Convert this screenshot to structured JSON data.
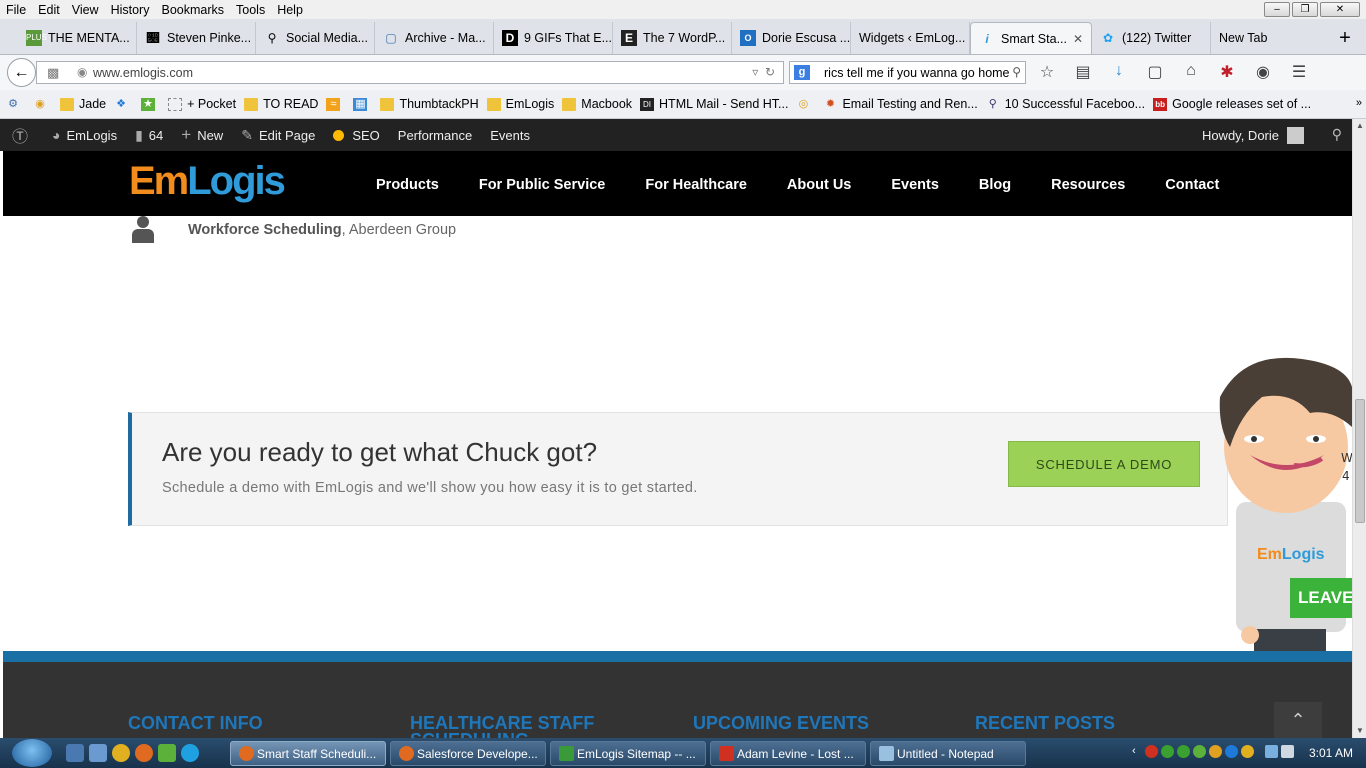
{
  "menubar": {
    "items": [
      "File",
      "Edit",
      "View",
      "History",
      "Bookmarks",
      "Tools",
      "Help"
    ]
  },
  "tabs": [
    {
      "label": "THE MENTA...",
      "icon": "plus-icon"
    },
    {
      "label": "Steven Pinke...",
      "icon": "nyt-icon"
    },
    {
      "label": "Social Media...",
      "icon": "search-icon"
    },
    {
      "label": "Archive - Ma...",
      "icon": "bookmark-icon"
    },
    {
      "label": "9 GIFs That E...",
      "icon": "d-icon"
    },
    {
      "label": "The 7 WordP...",
      "icon": "e-icon"
    },
    {
      "label": "Dorie Escusa ...",
      "icon": "outlook-icon"
    },
    {
      "label": "Widgets ‹ EmLog...",
      "icon": "none"
    },
    {
      "label": "Smart Sta...",
      "icon": "emlogis-icon",
      "active": true
    },
    {
      "label": "(122) Twitter",
      "icon": "twitter-icon"
    },
    {
      "label": "New Tab",
      "icon": "none"
    }
  ],
  "navbar": {
    "url": "www.emlogis.com",
    "search_value": "rics tell me if you wanna go home"
  },
  "bookmarks": [
    {
      "label": "",
      "icon": "gear-icon"
    },
    {
      "label": "",
      "icon": "chrome-icon"
    },
    {
      "label": "Jade",
      "icon": "folder-icon"
    },
    {
      "label": "",
      "icon": "dropbox-icon"
    },
    {
      "label": "",
      "icon": "evernote-icon"
    },
    {
      "label": "+ Pocket",
      "icon": "page-icon"
    },
    {
      "label": "TO READ",
      "icon": "folder-icon"
    },
    {
      "label": "",
      "icon": "rss-icon"
    },
    {
      "label": "",
      "icon": "grid-icon"
    },
    {
      "label": "ThumbtackPH",
      "icon": "folder-icon"
    },
    {
      "label": "EmLogis",
      "icon": "folder-icon"
    },
    {
      "label": "Macbook",
      "icon": "folder-icon"
    },
    {
      "label": "HTML Mail - Send HT...",
      "icon": "di-icon"
    },
    {
      "label": "",
      "icon": "circle-icon"
    },
    {
      "label": "Email Testing and Ren...",
      "icon": "litmus-icon"
    },
    {
      "label": "10 Successful Faceboo...",
      "icon": "search-icon"
    },
    {
      "label": "Google releases set of ...",
      "icon": "bb-icon"
    }
  ],
  "wpbar": {
    "site": "EmLogis",
    "comments": "64",
    "new": "New",
    "edit": "Edit Page",
    "seo": "SEO",
    "performance": "Performance",
    "events": "Events",
    "howdy": "Howdy, Dorie"
  },
  "site": {
    "logo_em": "Em",
    "logo_logis": "Logis",
    "nav": [
      "Products",
      "For Public Service",
      "For Healthcare",
      "About Us",
      "Events",
      "Blog",
      "Resources",
      "Contact"
    ]
  },
  "testimonial": {
    "source_bold": "Workforce Scheduling",
    "source_rest": ", Aberdeen Group"
  },
  "cta": {
    "heading": "Are you ready to get what Chuck got?",
    "sub": "Schedule a demo with EmLogis and we'll show you how easy it is to get started.",
    "button": "SCHEDULE A DEMO"
  },
  "mascot": {
    "shirt_logo": "EmLogis",
    "leave": "LEAVE"
  },
  "footer": {
    "col1": "CONTACT INFO",
    "col2": "HEALTHCARE STAFF SCHEDULING",
    "col3": "UPCOMING EVENTS",
    "col4": "RECENT POSTS"
  },
  "taskbar": {
    "items": [
      {
        "label": "Smart Staff Scheduli...",
        "active": true
      },
      {
        "label": "Salesforce Develope...",
        "active": false
      },
      {
        "label": "EmLogis Sitemap -- ...",
        "active": false
      },
      {
        "label": "Adam Levine - Lost ...",
        "active": false
      },
      {
        "label": "Untitled - Notepad",
        "active": false
      }
    ],
    "clock": "3:01 AM"
  },
  "colors": {
    "brand_orange": "#f28c1c",
    "brand_blue": "#2f9bd8",
    "cta_green": "#9bd156",
    "footer_blue": "#1a6fa5"
  }
}
